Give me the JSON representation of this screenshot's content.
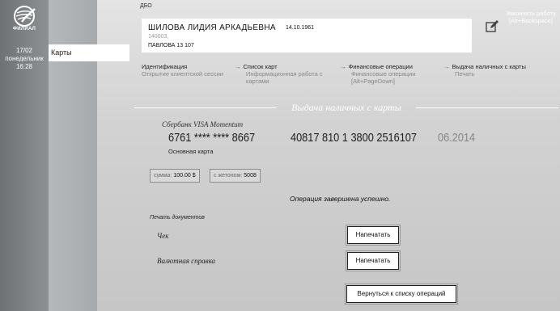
{
  "left_rail": {
    "logo_text": "ФИЛИАЛ",
    "date": "17/02",
    "weekday": "понедельник",
    "time": "16:28"
  },
  "sidebar": {
    "items": [
      {
        "label": "Карты"
      }
    ]
  },
  "header": {
    "breadcrumb": "ДБО",
    "finish_label": "Закончить работу [Alt+Backspace]",
    "edit_icon": "edit-icon"
  },
  "client": {
    "name": "ШИЛОВА ЛИДИЯ АРКАДЬЕВНА",
    "dob": "14.10.1961",
    "zip": "140003,",
    "address": "ПАВЛОВА 13 107"
  },
  "steps": [
    {
      "title": "Идентификация",
      "sub": "Открытие клиентской сессии"
    },
    {
      "title": "Список карт",
      "sub": "Информационная работа с картами"
    },
    {
      "title": "Финансовые операции",
      "sub": "Финансовые операции [Alt+PageDown]"
    },
    {
      "title": "Выдача наличных с карты",
      "sub": "Печать"
    }
  ],
  "section": {
    "title": "Выдача наличных с карты"
  },
  "card": {
    "product": "Сбербанк VISA Momentum",
    "number": "6761 **** **** 8667",
    "account": "40817 810 1 3800 2516107",
    "expiry": "06.2014",
    "type": "Основная карта"
  },
  "amounts": {
    "sum_label": "сумма:",
    "sum_value": "100.00 $",
    "token_label": "с жетоном:",
    "token_value": "5008"
  },
  "status": "Операция завершена успешно.",
  "print": {
    "header": "Печать документов",
    "docs": [
      {
        "label": "Чек",
        "button": "Напечатать"
      },
      {
        "label": "Валютная справка",
        "button": "Напечатать"
      }
    ]
  },
  "back_button": "Вернуться к списку операций",
  "colors": {
    "accent_white": "#ffffff",
    "rail_dark": "#6e7275"
  }
}
